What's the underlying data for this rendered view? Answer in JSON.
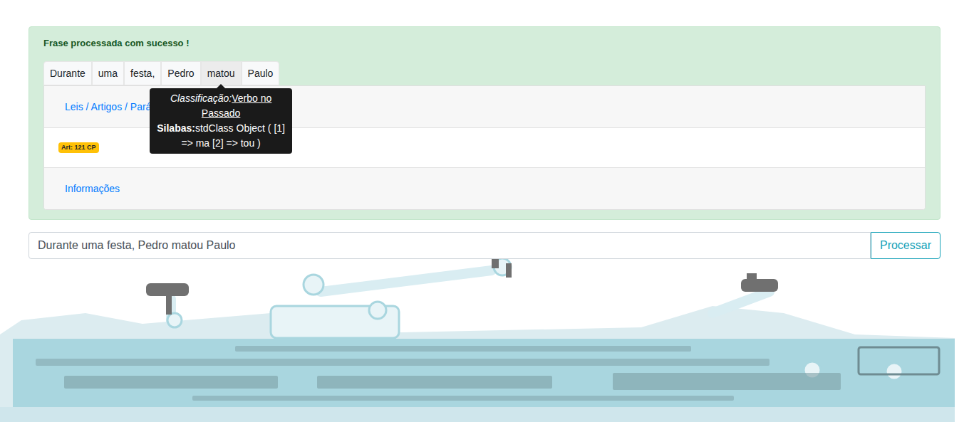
{
  "alert": {
    "message": "Frase processada com sucesso !"
  },
  "tokens": [
    {
      "text": "Durante",
      "selected": false
    },
    {
      "text": "uma",
      "selected": false
    },
    {
      "text": "festa,",
      "selected": false
    },
    {
      "text": "Pedro",
      "selected": false
    },
    {
      "text": "matou",
      "selected": true
    },
    {
      "text": "Paulo",
      "selected": false
    }
  ],
  "tooltip": {
    "classification_label": "Classificação:",
    "classification": "Verbo no Passado",
    "syllables_label": "Silabas:",
    "syllables": "stdClass Object ( [1] => ma [2] => tou )"
  },
  "card": {
    "header": "Leis / Artigos / Parágrafos",
    "badges": [
      "Art: 121 CP"
    ],
    "footer": "Informações"
  },
  "form": {
    "value": "Durante uma festa, Pedro matou Paulo",
    "button": "Processar"
  }
}
